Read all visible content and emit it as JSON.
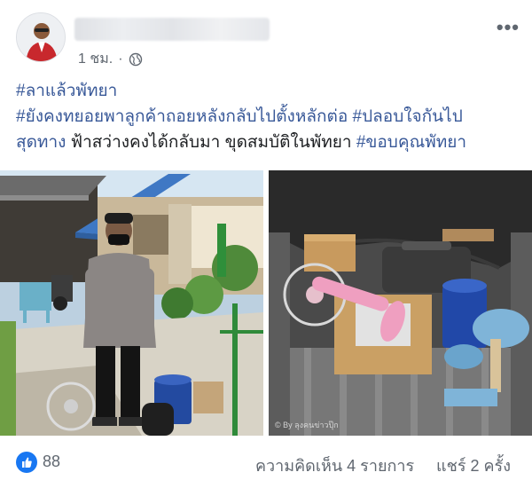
{
  "post": {
    "time": "1 ชม.",
    "separator": "·",
    "privacy_icon": "globe-icon",
    "more_icon": "more-options-icon",
    "text": {
      "line1": "#ลาแล้วพัทยา",
      "line2": "#ยังคงทยอยพาลูกค้าถอยหลังกลับไปตั้งหลักต่อ #ปลอบใจกันไป",
      "line3_tag": "สุดทาง",
      "line3_text": " ฟ้าสว่างคงได้กลับมา ขุดสมบัติในพัทยา ",
      "line3_tag2": "#ขอบคุณพัทยา"
    },
    "photo_watermark": "© By ลุงคนข่าวปุ๊ก"
  },
  "footer": {
    "reaction_icon": "like-icon",
    "like_count": "88",
    "comments": "ความคิดเห็น 4 รายการ",
    "shares": "แชร์ 2 ครั้ง"
  },
  "colors": {
    "hashtag": "#385898",
    "like_blue": "#1877f2",
    "meta_gray": "#606770"
  }
}
